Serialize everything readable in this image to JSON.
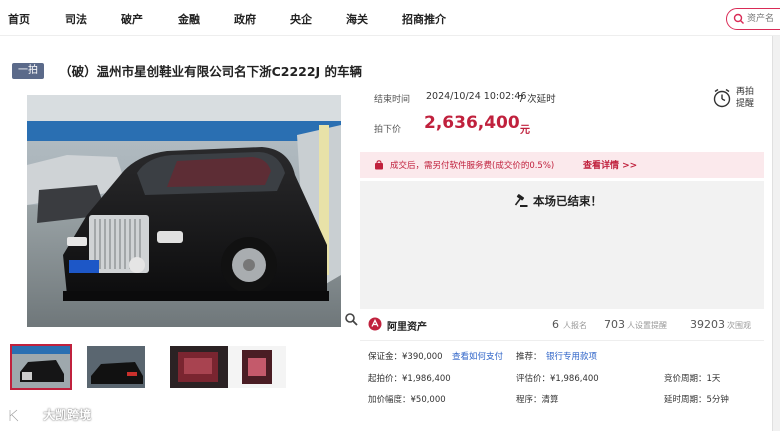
{
  "nav": {
    "items": [
      "首页",
      "司法",
      "破产",
      "金融",
      "政府",
      "央企",
      "海关",
      "招商推介"
    ],
    "search_placeholder": "资产名"
  },
  "title": {
    "round_badge": "一拍",
    "text": "（破）温州市星创鞋业有限公司名下浙C2222J 的车辆"
  },
  "auction": {
    "end_time_label": "结束时间",
    "end_time": "2024/10/24 10:02:46",
    "extensions": "7 次延时",
    "price_label": "拍下价",
    "price": "2,636,400",
    "price_unit": "元",
    "relist_label": "再拍提醒"
  },
  "notice": {
    "text": "成交后，需另付软件服务费(成交价的0.5%)",
    "link": "查看详情 >>"
  },
  "ended": {
    "text": "本场已结束！"
  },
  "platform": {
    "name": "阿里资产",
    "signups": "6",
    "signups_label": "人报名",
    "reminders": "703",
    "reminders_label": "人设置提醒",
    "views": "39203",
    "views_label": "次围观"
  },
  "details": {
    "deposit": "保证金：¥390,000",
    "pay_link": "查看如何支付",
    "recommend_label": "推荐：",
    "recommend_link": "银行专用款项",
    "start_price": "起拍价：¥1,986,400",
    "appraisal": "评估价：¥1,986,400",
    "period": "竞价周期：1天",
    "increment": "加价幅度：¥50,000",
    "procedure": "程序：清算",
    "delay": "延时周期：5分钟"
  },
  "watermark": {
    "text": "大凯跨境"
  },
  "colors": {
    "accent": "#c0213d",
    "badge": "#5b6a8a",
    "link": "#2d63c8",
    "notice_bg": "#fbe9ec",
    "ended_bg": "#f2f2f2"
  },
  "icons": [
    "search-icon",
    "clock-icon",
    "bag-icon",
    "gavel-icon",
    "ali-logo-icon",
    "zoom-icon",
    "watermark-logo-icon"
  ]
}
